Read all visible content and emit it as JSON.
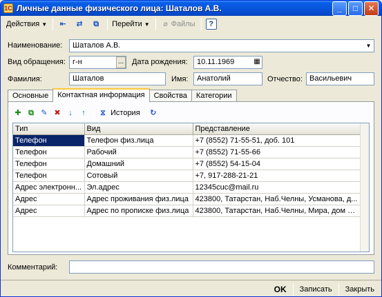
{
  "window": {
    "title": "Личные данные физического лица: Шаталов А.В.",
    "minimize": "_",
    "maximize": "□",
    "close": "✕"
  },
  "toolbar": {
    "actions_label": "Действия",
    "goto_label": "Перейти",
    "files_label": "Файлы",
    "help_label": "?"
  },
  "form": {
    "name_label": "Наименование:",
    "name_value": "Шаталов А.В.",
    "address_label": "Вид обращения:",
    "address_value": "г-н",
    "ellipsis": "...",
    "birth_label": "Дата рождения:",
    "birth_value": "10.11.1969",
    "surname_label": "Фамилия:",
    "surname_value": "Шаталов",
    "firstname_label": "Имя:",
    "firstname_value": "Анатолий",
    "patronymic_label": "Отчество:",
    "patronymic_value": "Васильевич",
    "comment_label": "Комментарий:",
    "comment_value": ""
  },
  "tabs": [
    "Основные",
    "Контактная информация",
    "Свойства",
    "Категории"
  ],
  "active_tab": 1,
  "panel_toolbar": {
    "history_label": "История"
  },
  "grid": {
    "columns": [
      "Тип",
      "Вид",
      "Представление"
    ],
    "rows": [
      [
        "Телефон",
        "Телефон физ.лица",
        "+7 (8552) 71-55-51, доб. 101"
      ],
      [
        "Телефон",
        "Рабочий",
        "+7 (8552) 71-55-66"
      ],
      [
        "Телефон",
        "Домашний",
        "+7 (8552) 54-15-04"
      ],
      [
        "Телефон",
        "Сотовый",
        "+7, 917-288-21-21"
      ],
      [
        "Адрес электронн...",
        "Эл.адрес",
        "12345cuc@mail.ru"
      ],
      [
        "Адрес",
        "Адрес проживания физ.лица",
        "423800, Татарстан, Наб.Челны, Усманова, д..."
      ],
      [
        "Адрес",
        "Адрес по прописке физ.лица",
        "423800, Татарстан, Наб.Челны, Мира, дом №..."
      ]
    ]
  },
  "footer": {
    "ok_label": "OK",
    "save_label": "Записать",
    "close_label": "Закрыть"
  },
  "colors": {
    "title_bar": "#0855dd",
    "selection": "#0a246a"
  }
}
